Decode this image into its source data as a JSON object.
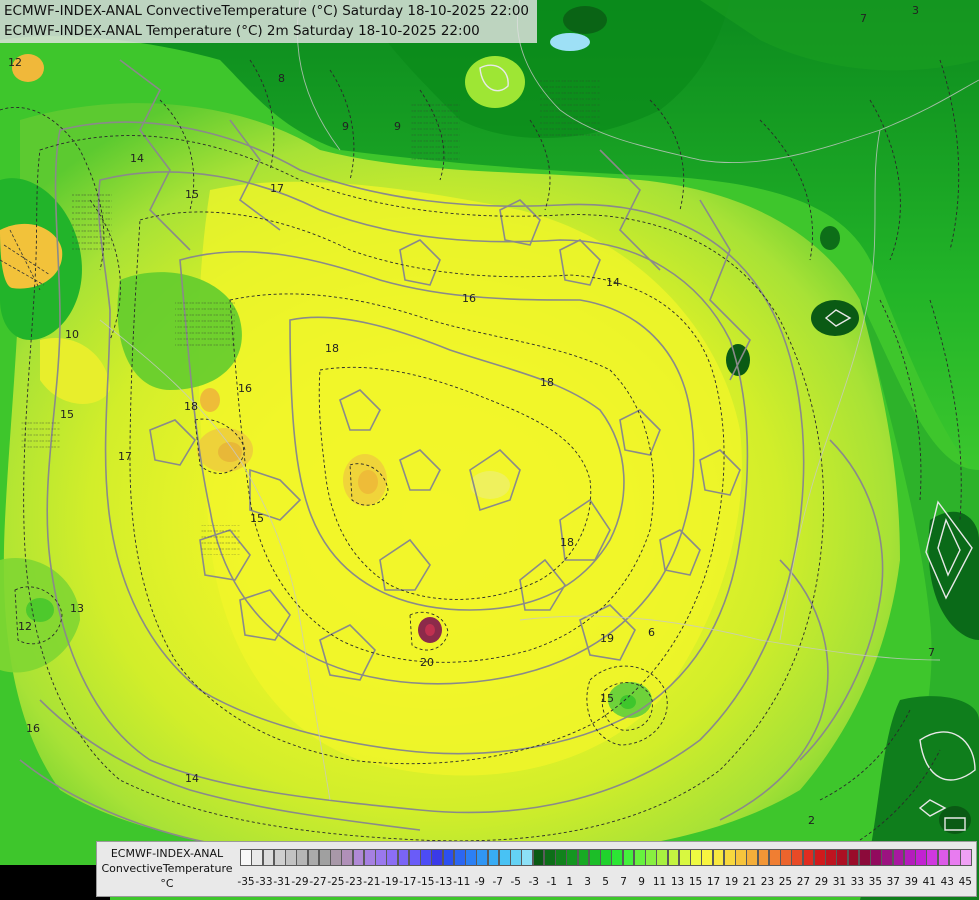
{
  "header": {
    "line1": "ECMWF-INDEX-ANAL ConvectiveTemperature (°C) Saturday 18-10-2025 22:00",
    "line2": "ECMWF-INDEX-ANAL Temperature (°C) 2m Saturday 18-10-2025 22:00"
  },
  "legend": {
    "title_lines": [
      "ECMWF-INDEX-ANAL",
      "ConvectiveTemperature",
      "°C"
    ],
    "labels": [
      "-35",
      "-33",
      "-31",
      "-29",
      "-27",
      "-25",
      "-23",
      "-21",
      "-19",
      "-17",
      "-15",
      "-13",
      "-11",
      "-9",
      "-7",
      "-5",
      "-3",
      "-1",
      "1",
      "3",
      "5",
      "7",
      "9",
      "11",
      "13",
      "15",
      "17",
      "19",
      "21",
      "23",
      "25",
      "27",
      "29",
      "31",
      "33",
      "35",
      "37",
      "39",
      "41",
      "43",
      "45"
    ],
    "colors": [
      "#f7f7f7",
      "#e9e9e9",
      "#dcdcdc",
      "#cfcfcf",
      "#c2c2c2",
      "#b6b6b6",
      "#aaaaaa",
      "#a0a0a0",
      "#a898a8",
      "#b090b8",
      "#b089d6",
      "#a680e2",
      "#9a78ee",
      "#8c6ef4",
      "#7a64f6",
      "#6a5cf8",
      "#4c4cf6",
      "#3a3ae8",
      "#2c50f0",
      "#2c66f2",
      "#2c80f4",
      "#3096f4",
      "#38acf4",
      "#48c2f4",
      "#64d2f4",
      "#8ce0f6",
      "#0a5a14",
      "#0d6e18",
      "#11821c",
      "#149620",
      "#18aa24",
      "#1cbe28",
      "#20d22c",
      "#2ce634",
      "#44f03c",
      "#66f23e",
      "#88f040",
      "#a8f040",
      "#c4f440",
      "#d8f840",
      "#eefa42",
      "#f8f440",
      "#f8e840",
      "#f8d83e",
      "#f6c43c",
      "#f4ae3a",
      "#f29636",
      "#f07e32",
      "#ec642c",
      "#e84a26",
      "#e02c20",
      "#d01a1c",
      "#be1420",
      "#ac1024",
      "#9a0c2a",
      "#8c0a3a",
      "#920a5e",
      "#9c1280",
      "#a818a0",
      "#b41cbc",
      "#c222d2",
      "#d038e0",
      "#dc5ae8",
      "#e87cf0",
      "#f0a0f4"
    ]
  },
  "contour_labels": [
    "12",
    "13",
    "14",
    "15",
    "16",
    "17",
    "18",
    "19",
    "10",
    "9",
    "8",
    "7",
    "6",
    "3",
    "20",
    "2"
  ]
}
